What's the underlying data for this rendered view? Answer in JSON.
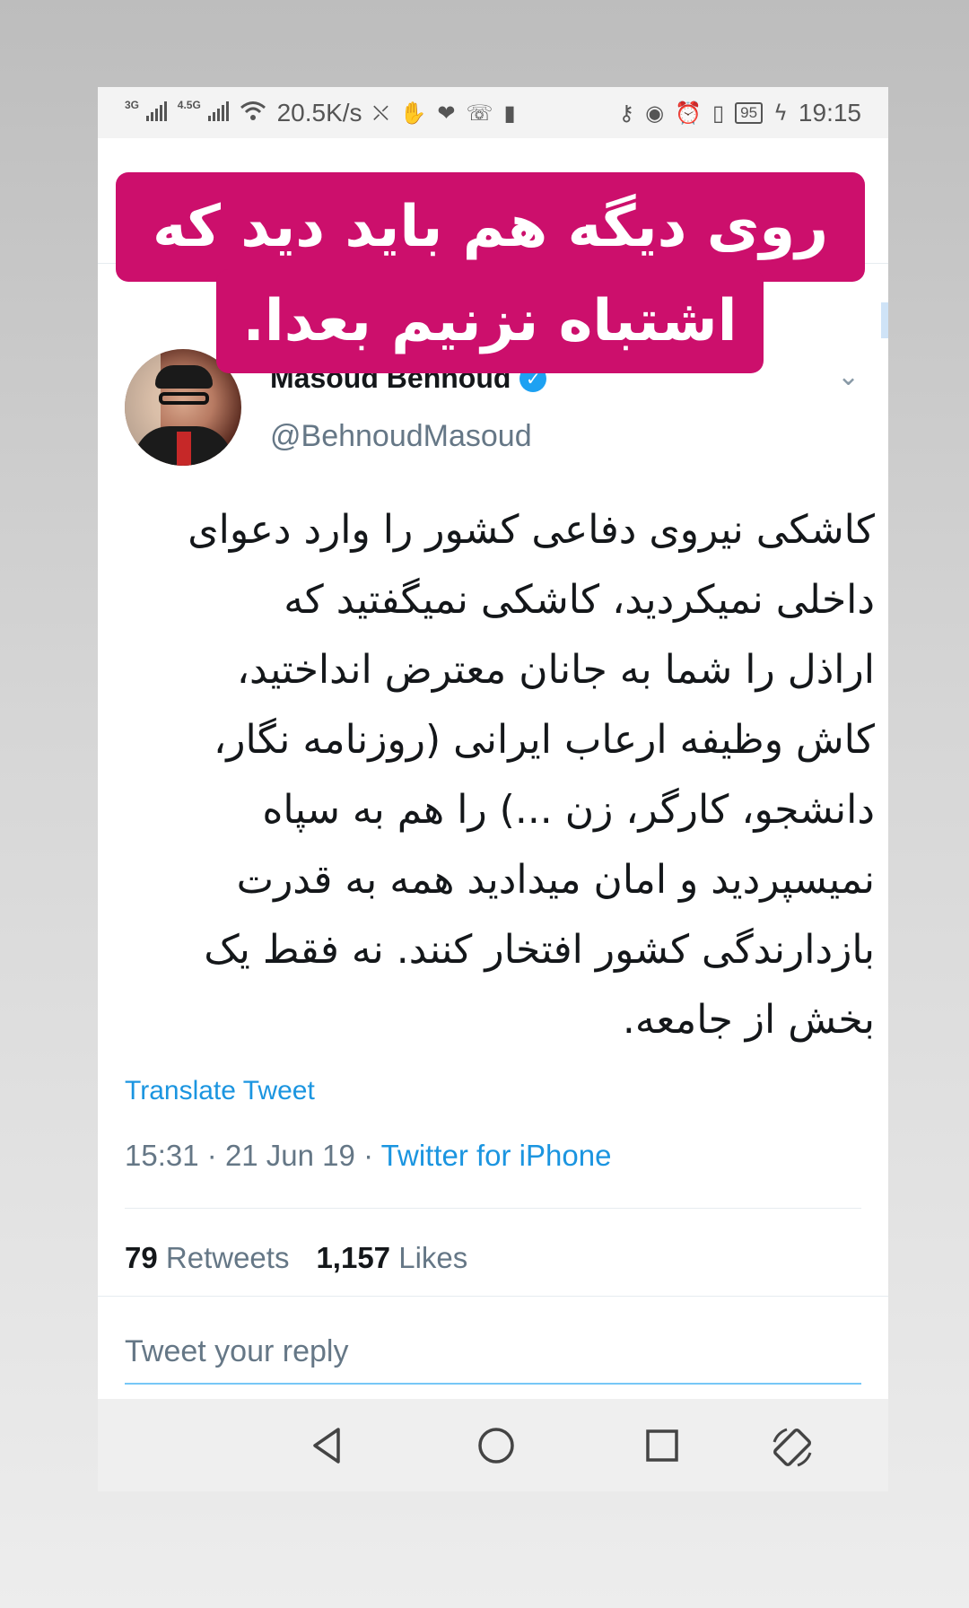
{
  "status_bar": {
    "network_1": "3G",
    "network_2": "4.5G",
    "speed": "20.5K/s",
    "battery": "95",
    "time": "19:15",
    "left_icons": [
      "sim-icon",
      "wifi-icon",
      "no-notification-icon",
      "gesture-icon",
      "heart-icon",
      "whatsapp-icon",
      "battery-saver-icon"
    ],
    "right_icons": [
      "key-icon",
      "eye-icon",
      "alarm-icon",
      "vibrate-icon",
      "charging-icon"
    ]
  },
  "overlay": {
    "line1": "روی دیگه هم باید دید که",
    "line2": "اشتباه نزنیم بعدا.",
    "color": "#cc0f6c"
  },
  "tweet": {
    "display_name": "Masoud Behnoud",
    "handle": "@BehnoudMasoud",
    "verified": true,
    "text_lines": [
      "کاشکی نیروی دفاعی کشور را وارد دعوای",
      "داخلی نمیکردید، کاشکی نمیگفتید که",
      "اراذل را شما به جانان معترض انداختید،",
      "کاش وظیفه ارعاب ایرانی (روزنامه نگار،",
      "دانشجو، کارگر، زن ...) را هم به سپاه",
      "نمیسپردید و امان میدادید همه به قدرت",
      "بازدارندگی کشور افتخار کنند. نه فقط یک",
      "بخش از جامعه."
    ],
    "translate_label": "Translate Tweet",
    "time": "15:31",
    "separator": "·",
    "date": "21 Jun 19",
    "source": "Twitter for iPhone",
    "retweets_count": "79",
    "retweets_label": "Retweets",
    "likes_count": "1,157",
    "likes_label": "Likes",
    "reply_placeholder": "Tweet your reply",
    "link_color": "#1b95e0"
  },
  "nav_bar": {
    "buttons": [
      "back-icon",
      "home-icon",
      "recents-icon",
      "rotate-icon"
    ]
  }
}
